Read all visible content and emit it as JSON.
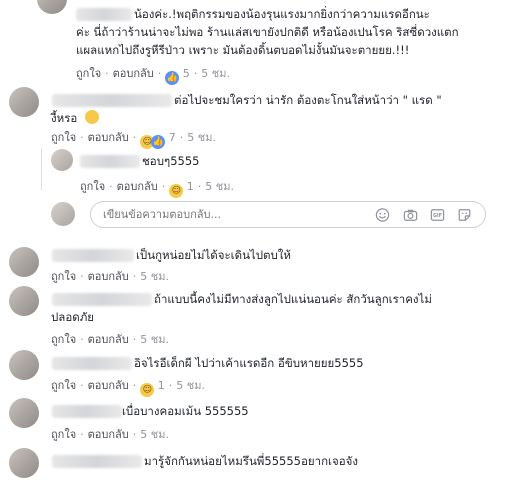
{
  "comments": [
    {
      "id": "c1",
      "lines": [
        "น้องค่ะ.!พฤติกรรมของน้องรุนแรงมากยิ่งกว่าความแรดอีกนะ",
        "ค่ะ นี่ถ้าว่าร้านน่าจะไม่พอ ร้านแล่สเขายังปกติดี หรือน้องเปนโรค ริสซี่ดวงแตก",
        "แผลแหกไปถึงรูหีรีป่าว เพราะ มันต้องดิ้นตบอดไม่งั้นมันจะตายยย.!!!"
      ],
      "like": "ถูกใจ",
      "reply": "ตอบกลับ",
      "reaction_count": "5",
      "time": "5 ชม."
    },
    {
      "id": "c2",
      "lines": [
        "ต่อไปจะชมใครว่า น่ารัก ต้องตะโกนใส่หน้าว่า \" แรด \"",
        "งี้หรอ"
      ],
      "like": "ถูกใจ",
      "reply": "ตอบกลับ",
      "reaction_count": "7",
      "time": "5 ชม."
    },
    {
      "id": "r1",
      "lines": [
        "ชอบๆ5555"
      ],
      "like": "ถูกใจ",
      "reply": "ตอบกลับ",
      "reaction_count": "1",
      "time": "5 ชม."
    },
    {
      "id": "c3",
      "lines": [
        "เป็นกูหน่อยไม่ได้จะเดินไปตบให้"
      ],
      "like": "ถูกใจ",
      "reply": "ตอบกลับ",
      "reaction_count": "",
      "time": "5 ชม."
    },
    {
      "id": "c4",
      "lines": [
        "ถ้าแบบนี้คงไม่มีทางส่งลูกไปแน่นอนค่ะ สักวันลูกเราคงไม่",
        "ปลอดภัย"
      ],
      "like": "ถูกใจ",
      "reply": "ตอบกลับ",
      "reaction_count": "",
      "time": "5 ชม."
    },
    {
      "id": "c5",
      "lines": [
        "อิจไรอีเด็กผี ไปว่าเค้าแรดอีก อีขิบหายยย5555"
      ],
      "like": "ถูกใจ",
      "reply": "ตอบกลับ",
      "reaction_count": "1",
      "time": "5 ชม."
    },
    {
      "id": "c6",
      "lines": [
        "เบื่อบางคอมเม้น 555555"
      ],
      "like": "ถูกใจ",
      "reply": "ตอบกลับ",
      "reaction_count": "",
      "time": "5 ชม."
    },
    {
      "id": "c7",
      "lines": [
        "มารู้จักกันหน่อยไหมรึนพี่55555อยากเจอจัง"
      ],
      "like": "",
      "reply": "",
      "reaction_count": "",
      "time": ""
    }
  ],
  "reply_input": {
    "placeholder": "เขียนข้อความตอบกลับ..."
  },
  "icons": {
    "like": "thumbs-up-icon",
    "haha": "laughing-face-icon",
    "emoji": "smiley-icon",
    "camera": "camera-icon",
    "gif": "gif-icon",
    "sticker": "sticker-icon",
    "rolleyes": "rolling-eyes-emoji"
  },
  "colors": {
    "link": "#4b4f56",
    "meta": "#90949c",
    "like_blue": "#5890ff",
    "haha_yellow": "#f7c94a"
  }
}
